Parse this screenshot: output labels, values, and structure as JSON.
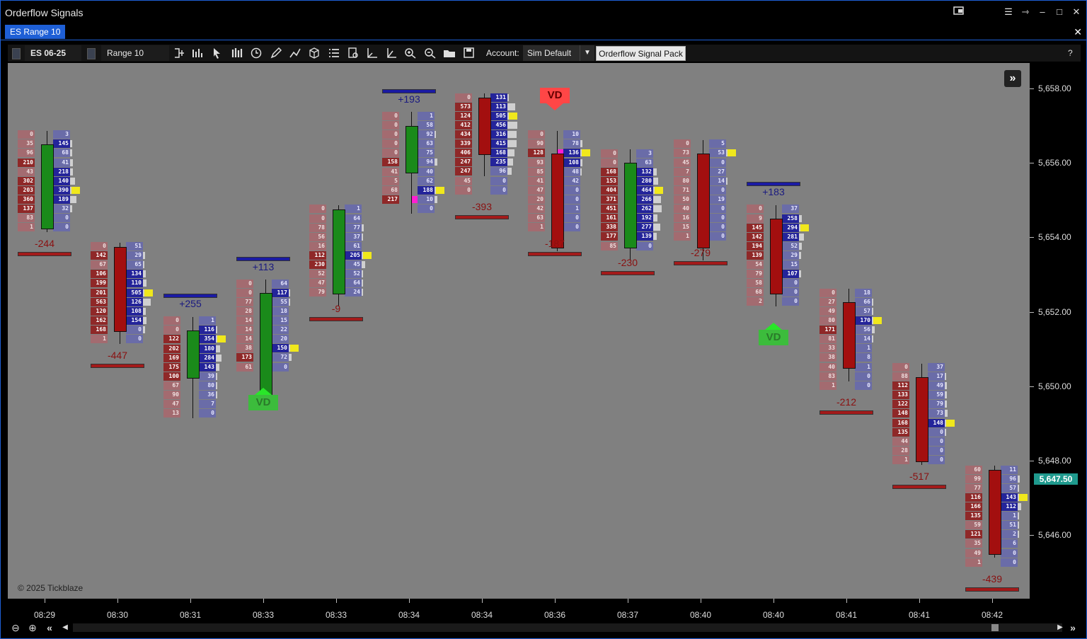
{
  "window": {
    "title": "Orderflow Signals"
  },
  "tab": {
    "label": "ES Range 10"
  },
  "toolbar": {
    "instrument": "ES 06-25",
    "bar_type": "Range 10",
    "account_label": "Account:",
    "account_value": "Sim Default",
    "indicator_button": "Orderflow Signal Pack",
    "help": "?"
  },
  "chart": {
    "copyright": "© 2025 Tickblaze",
    "last_price": "5,647.50",
    "price_labels": [
      "5,658.00",
      "5,656.00",
      "5,654.00",
      "5,652.00",
      "5,650.00",
      "5,648.00",
      "5,646.00"
    ],
    "time_labels": [
      "08:29",
      "08:30",
      "08:31",
      "08:33",
      "08:33",
      "08:34",
      "08:34",
      "08:36",
      "08:37",
      "08:40",
      "08:40",
      "08:41",
      "08:41",
      "08:42"
    ]
  },
  "colors": {
    "accent": "#1e5fd6",
    "bid": "#a36b70",
    "ask": "#6a6ca8",
    "bull": "#1a8a1a",
    "bear": "#a30f0f",
    "last_price": "#1f9a8e"
  },
  "chart_data": {
    "type": "footprint",
    "instrument": "ES 06-25",
    "tick_size": 0.25,
    "bars": [
      {
        "time": "08:29",
        "open": 5654.25,
        "close": 5656.5,
        "top": 5656.75,
        "bottom": 5654.25,
        "delta": "-244",
        "bid": [
          "0",
          "35",
          "96",
          "210",
          "43",
          "302",
          "203",
          "360",
          "137",
          "83",
          "1"
        ],
        "ask": [
          "3",
          "145",
          "68",
          "41",
          "218",
          "140",
          "390",
          "189",
          "32",
          "0",
          "0"
        ]
      },
      {
        "time": "08:30",
        "open": 5653.75,
        "close": 5651.5,
        "top": 5653.75,
        "bottom": 5651.25,
        "delta": "-447",
        "bid": [
          "0",
          "142",
          "67",
          "106",
          "199",
          "201",
          "563",
          "120",
          "162",
          "168",
          "1"
        ],
        "ask": [
          "51",
          "29",
          "65",
          "134",
          "110",
          "505",
          "126",
          "108",
          "154",
          "0",
          "0"
        ]
      },
      {
        "time": "08:31",
        "open": 5650.25,
        "close": 5651.5,
        "top": 5651.75,
        "bottom": 5649.25,
        "delta": "+255",
        "bid": [
          "0",
          "0",
          "122",
          "202",
          "169",
          "175",
          "100",
          "67",
          "90",
          "47",
          "13"
        ],
        "ask": [
          "1",
          "116",
          "354",
          "180",
          "284",
          "143",
          "39",
          "80",
          "36",
          "7",
          "0"
        ]
      },
      {
        "time": "08:33",
        "open": 5649.75,
        "close": 5652.5,
        "top": 5652.75,
        "bottom": 5650.25,
        "delta": "+113",
        "signal": "VD",
        "bid": [
          "0",
          "0",
          "77",
          "28",
          "14",
          "14",
          "14",
          "38",
          "173",
          "61"
        ],
        "ask": [
          "64",
          "117",
          "55",
          "18",
          "15",
          "22",
          "20",
          "150",
          "72",
          "0"
        ]
      },
      {
        "time": "08:33",
        "open": 5652.5,
        "close": 5654.75,
        "top": 5654.75,
        "bottom": 5652.25,
        "delta": "-9",
        "bid": [
          "0",
          "0",
          "78",
          "56",
          "16",
          "112",
          "230",
          "52",
          "47",
          "79"
        ],
        "ask": [
          "1",
          "64",
          "77",
          "37",
          "61",
          "205",
          "45",
          "52",
          "64",
          "24"
        ]
      },
      {
        "time": "08:34",
        "open": 5655.75,
        "close": 5657.0,
        "top": 5657.25,
        "bottom": 5654.75,
        "delta": "+193",
        "bid": [
          "0",
          "0",
          "0",
          "0",
          "0",
          "158",
          "41",
          "5",
          "68",
          "217"
        ],
        "ask": [
          "1",
          "58",
          "92",
          "63",
          "75",
          "94",
          "40",
          "62",
          "188",
          "10",
          "0"
        ]
      },
      {
        "time": "08:34",
        "open": 5657.75,
        "close": 5656.25,
        "top": 5657.75,
        "bottom": 5655.75,
        "delta": "-393",
        "bid": [
          "0",
          "573",
          "124",
          "412",
          "434",
          "339",
          "406",
          "247",
          "247",
          "45",
          "0"
        ],
        "ask": [
          "131",
          "113",
          "505",
          "456",
          "316",
          "415",
          "168",
          "235",
          "96",
          "0",
          "0"
        ]
      },
      {
        "time": "08:36",
        "open": 5656.25,
        "close": 5653.75,
        "top": 5656.75,
        "bottom": 5653.75,
        "delta": "-187",
        "signal": "VD",
        "bid": [
          "0",
          "90",
          "128",
          "93",
          "85",
          "41",
          "47",
          "20",
          "42",
          "63",
          "1"
        ],
        "ask": [
          "10",
          "78",
          "136",
          "108",
          "48",
          "42",
          "0",
          "0",
          "1",
          "0",
          "0"
        ]
      },
      {
        "time": "08:37",
        "open": 5653.75,
        "close": 5656.0,
        "top": 5656.25,
        "bottom": 5653.5,
        "delta": "-230",
        "bid": [
          "0",
          "0",
          "168",
          "153",
          "404",
          "371",
          "451",
          "161",
          "338",
          "177",
          "85"
        ],
        "ask": [
          "3",
          "63",
          "132",
          "280",
          "464",
          "266",
          "262",
          "192",
          "277",
          "139",
          "0"
        ]
      },
      {
        "time": "08:40",
        "open": 5656.25,
        "close": 5653.75,
        "top": 5656.5,
        "bottom": 5653.5,
        "delta": "-279",
        "bid": [
          "0",
          "73",
          "45",
          "7",
          "80",
          "71",
          "50",
          "40",
          "16",
          "15",
          "1"
        ],
        "ask": [
          "5",
          "53",
          "0",
          "27",
          "14",
          "0",
          "19",
          "0",
          "0",
          "0",
          "0"
        ]
      },
      {
        "time": "08:40",
        "open": 5654.5,
        "close": 5652.5,
        "top": 5654.75,
        "bottom": 5652.25,
        "delta": "+183",
        "signal": "VD",
        "bid": [
          "0",
          "9",
          "145",
          "142",
          "194",
          "139",
          "54",
          "79",
          "58",
          "68",
          "2"
        ],
        "ask": [
          "37",
          "258",
          "294",
          "281",
          "52",
          "29",
          "15",
          "107",
          "0",
          "0",
          "0"
        ]
      },
      {
        "time": "08:41",
        "open": 5652.25,
        "close": 5650.5,
        "top": 5652.5,
        "bottom": 5650.25,
        "delta": "-212",
        "bid": [
          "0",
          "27",
          "49",
          "80",
          "171",
          "81",
          "33",
          "38",
          "40",
          "83",
          "1"
        ],
        "ask": [
          "18",
          "66",
          "57",
          "170",
          "56",
          "14",
          "1",
          "8",
          "1",
          "0",
          "0"
        ]
      },
      {
        "time": "08:41",
        "open": 5650.25,
        "close": 5648.0,
        "top": 5650.5,
        "bottom": 5648.0,
        "delta": "-517",
        "bid": [
          "0",
          "88",
          "112",
          "133",
          "122",
          "148",
          "168",
          "135",
          "44",
          "28",
          "1"
        ],
        "ask": [
          "37",
          "17",
          "49",
          "59",
          "79",
          "73",
          "148",
          "0",
          "0",
          "0",
          "0"
        ]
      },
      {
        "time": "08:42",
        "open": 5647.75,
        "close": 5645.5,
        "top": 5647.75,
        "bottom": 5645.5,
        "delta": "-439",
        "bid": [
          "60",
          "99",
          "77",
          "116",
          "166",
          "135",
          "59",
          "121",
          "35",
          "49",
          "1"
        ],
        "ask": [
          "11",
          "96",
          "57",
          "143",
          "112",
          "1",
          "51",
          "2",
          "6",
          "0",
          "0"
        ]
      }
    ]
  }
}
